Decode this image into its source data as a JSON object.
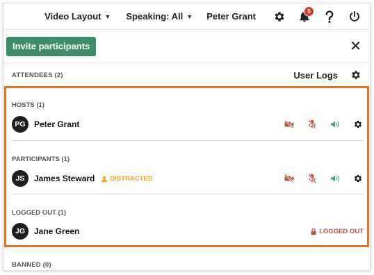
{
  "colors": {
    "accent_green": "#3e8d6a",
    "highlight_orange": "#e8741a",
    "muted_red": "#b5533f",
    "speaker_green": "#4aa57b",
    "distracted_orange": "#f0a420",
    "logged_out_red": "#b5533f",
    "badge_red": "#d93a2b"
  },
  "topbar": {
    "video_layout": "Video Layout",
    "speaking": "Speaking: All",
    "user_name": "Peter Grant",
    "notification_count": "5",
    "icons": [
      "gear-icon",
      "bell-icon",
      "help-icon",
      "power-icon"
    ]
  },
  "invite": {
    "label": "Invite participants",
    "close": "✕"
  },
  "attendees": {
    "label": "ATTENDEES (2)",
    "user_logs": "User Logs"
  },
  "sections": {
    "hosts": {
      "title": "HOSTS (1)",
      "people": [
        {
          "initials": "PG",
          "name": "Peter Grant"
        }
      ]
    },
    "participants": {
      "title": "PARTICIPANTS (1)",
      "people": [
        {
          "initials": "JS",
          "name": "James Steward",
          "status": "DISTRACTED"
        }
      ]
    },
    "logged_out": {
      "title": "LOGGED OUT (1)",
      "people": [
        {
          "initials": "JG",
          "name": "Jane Green",
          "status": "LOGGED OUT"
        }
      ]
    },
    "banned": {
      "title": "BANNED (0)"
    }
  }
}
